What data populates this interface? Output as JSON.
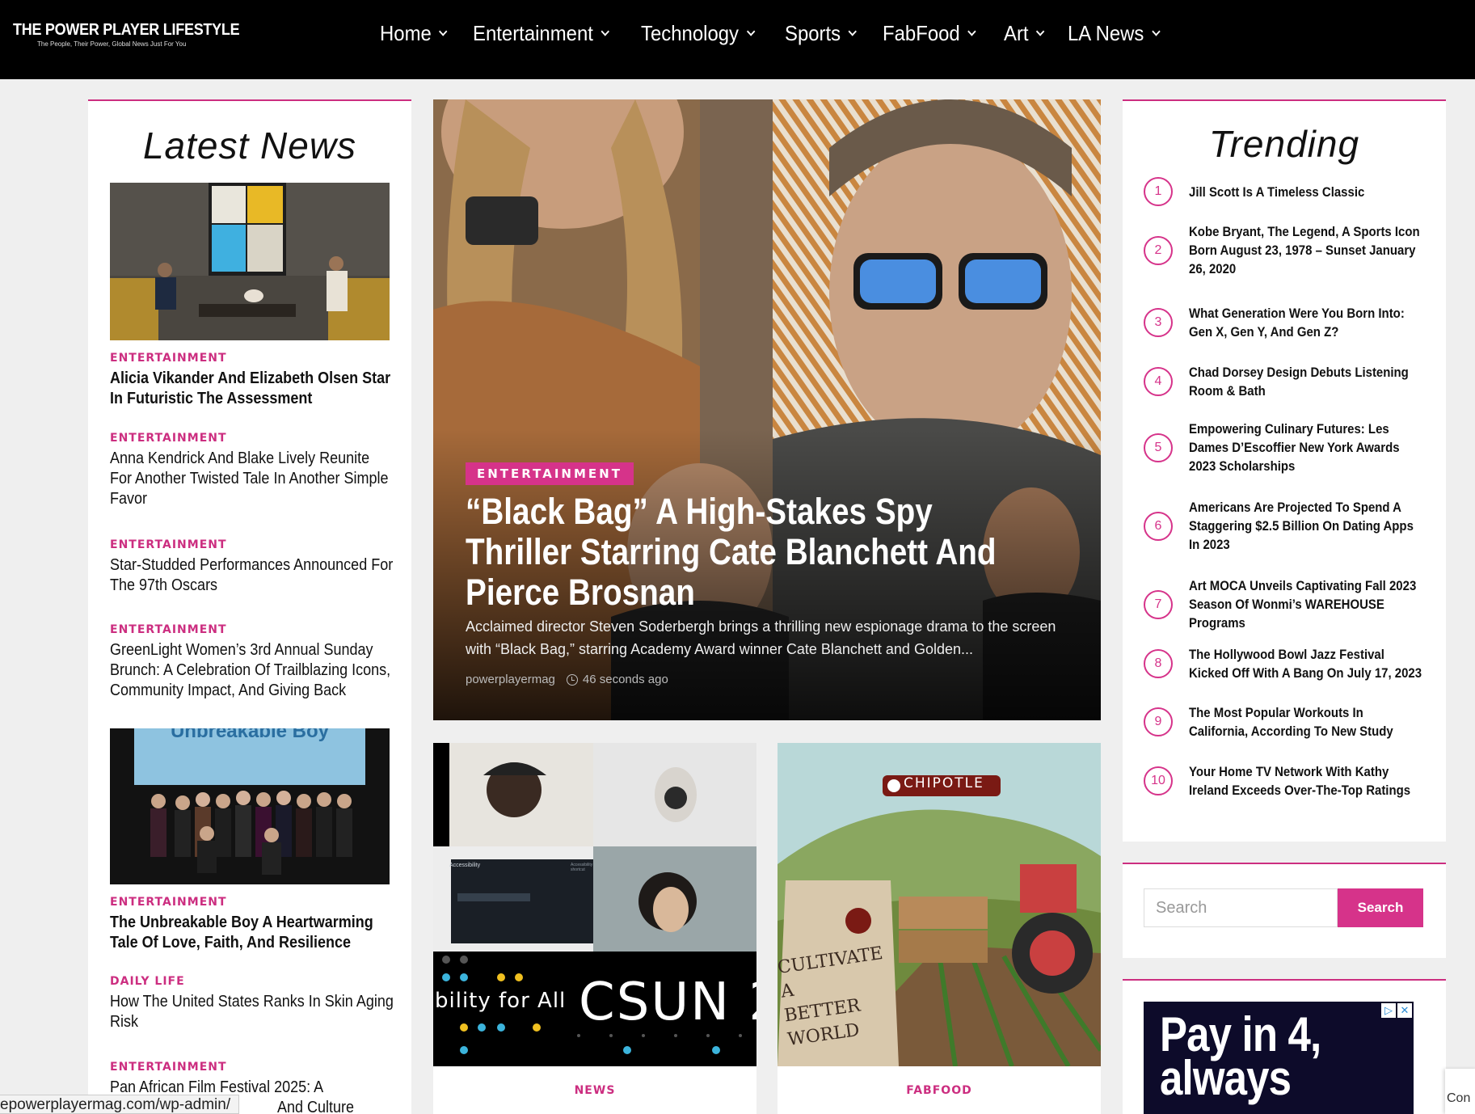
{
  "brand": {
    "title": "THE POWER PLAYER LIFESTYLE",
    "tagline": "The People, Their Power, Global News Just For You"
  },
  "nav": [
    {
      "label": "Home"
    },
    {
      "label": "Entertainment"
    },
    {
      "label": "Technology"
    },
    {
      "label": "Sports"
    },
    {
      "label": "FabFood"
    },
    {
      "label": "Art"
    },
    {
      "label": "LA News"
    }
  ],
  "latest": {
    "title": "Latest News",
    "items": [
      {
        "category": "ENTERTAINMENT",
        "headline": "Alicia Vikander And Elizabeth Olsen Star In Futuristic The Assessment"
      },
      {
        "category": "ENTERTAINMENT",
        "headline": "Anna Kendrick And Blake Lively Reunite For Another Twisted Tale In Another Simple Favor"
      },
      {
        "category": "ENTERTAINMENT",
        "headline": "Star-Studded Performances Announced For The 97th Oscars"
      },
      {
        "category": "ENTERTAINMENT",
        "headline": "GreenLight Women’s 3rd Annual Sunday Brunch: A Celebration Of Trailblazing Icons, Community Impact, And Giving Back"
      },
      {
        "category": "ENTERTAINMENT",
        "headline": "The Unbreakable Boy A Heartwarming Tale Of Love, Faith, And Resilience",
        "image_text": "Unbreakable Boy"
      },
      {
        "category": "DAILY LIFE",
        "headline": "How The United States Ranks In Skin Aging Risk"
      },
      {
        "category": "ENTERTAINMENT",
        "headline": "Pan African Film Festival 2025: A"
      },
      {
        "category": "",
        "headline": "And Culture"
      }
    ]
  },
  "hero": {
    "category": "ENTERTAINMENT",
    "title": "“Black Bag” A High-Stakes Spy Thriller Starring Cate Blanchett And Pierce Brosnan",
    "excerpt": "Acclaimed director Steven Soderbergh brings a thrilling new espionage drama to the screen with “Black Bag,” starring Academy Award winner Cate Blanchett and Golden...",
    "author": "powerplayermag",
    "time": "46 seconds ago"
  },
  "cards": [
    {
      "category": "NEWS",
      "image_text": "bility for All",
      "image_text2": "CSUN 2",
      "image_ui": {
        "title": "Accessibility",
        "sub": "Accessibility shortcut"
      }
    },
    {
      "category": "FABFOOD",
      "image_text": "CHIPOTLE",
      "bag_text": "CULTIVATE A BETTER WORLD"
    }
  ],
  "trending": {
    "title": "Trending",
    "items": [
      {
        "num": "1",
        "text": "Jill Scott Is A Timeless Classic"
      },
      {
        "num": "2",
        "text": "Kobe Bryant, The Legend, A Sports Icon Born August 23, 1978 – Sunset January 26, 2020"
      },
      {
        "num": "3",
        "text": "What Generation Were You Born Into: Gen X, Gen Y, And Gen Z?"
      },
      {
        "num": "4",
        "text": "Chad Dorsey Design Debuts Listening Room & Bath"
      },
      {
        "num": "5",
        "text": "Empowering Culinary Futures: Les Dames D’Escoffier New York Awards 2023 Scholarships"
      },
      {
        "num": "6",
        "text": "Americans Are Projected To Spend A Staggering $2.5 Billion On Dating Apps In 2023"
      },
      {
        "num": "7",
        "text": "Art MOCA Unveils Captivating Fall 2023 Season Of Wonmi’s WAREHOUSE Programs"
      },
      {
        "num": "8",
        "text": "The Hollywood Bowl Jazz Festival Kicked Off With A Bang On July 17, 2023"
      },
      {
        "num": "9",
        "text": "The Most Popular Workouts In California, According To New Study"
      },
      {
        "num": "10",
        "text": "Your Home TV Network With Kathy Ireland Exceeds Over-The-Top Ratings"
      }
    ]
  },
  "search": {
    "placeholder": "Search",
    "button": "Search"
  },
  "ad": {
    "text_line1": "Pay in 4,",
    "text_line2": "always"
  },
  "status_url": "epowerplayermag.com/wp-admin/",
  "corner_text": "Con",
  "colors": {
    "accent": "#d6338a",
    "header_bg": "#000000",
    "page_bg": "#efefef"
  }
}
